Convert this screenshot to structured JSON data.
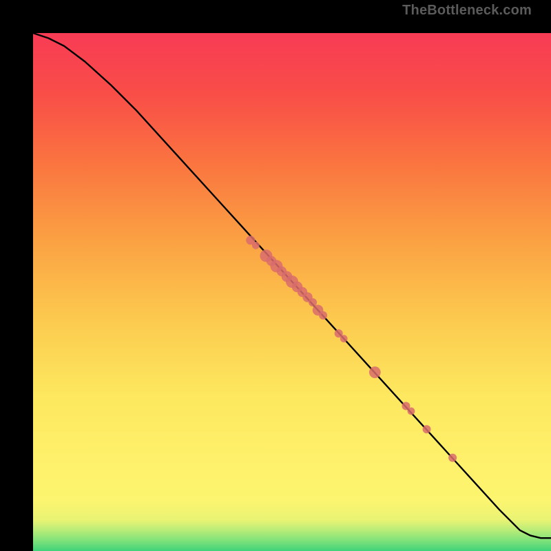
{
  "watermark": "TheBottleneck.com",
  "chart_data": {
    "type": "line",
    "title": "",
    "xlabel": "",
    "ylabel": "",
    "xlim": [
      0,
      100
    ],
    "ylim": [
      0,
      100
    ],
    "grid": false,
    "legend": false,
    "curve": {
      "name": "performance-curve",
      "x": [
        0,
        3,
        6,
        10,
        15,
        20,
        25,
        30,
        35,
        40,
        45,
        50,
        55,
        60,
        65,
        70,
        75,
        80,
        85,
        90,
        94,
        96,
        98,
        100
      ],
      "y": [
        100,
        99,
        97.5,
        94.5,
        90,
        85,
        79.5,
        74,
        68.5,
        63,
        57.5,
        52,
        46.5,
        41,
        35.5,
        30,
        24.5,
        19,
        13.5,
        8,
        4,
        3,
        2.5,
        2.5
      ]
    },
    "points": {
      "name": "data-points",
      "values": [
        {
          "x": 42,
          "y": 60,
          "r_rel": 1.1
        },
        {
          "x": 43,
          "y": 59,
          "r_rel": 0.9
        },
        {
          "x": 45,
          "y": 57,
          "r_rel": 1.5
        },
        {
          "x": 46,
          "y": 56,
          "r_rel": 1.2
        },
        {
          "x": 47,
          "y": 55,
          "r_rel": 1.5
        },
        {
          "x": 48,
          "y": 54,
          "r_rel": 1.2
        },
        {
          "x": 49,
          "y": 53,
          "r_rel": 1.3
        },
        {
          "x": 50,
          "y": 52,
          "r_rel": 1.5
        },
        {
          "x": 51,
          "y": 51,
          "r_rel": 1.3
        },
        {
          "x": 52,
          "y": 50,
          "r_rel": 1.2
        },
        {
          "x": 53,
          "y": 49,
          "r_rel": 1.2
        },
        {
          "x": 54,
          "y": 48,
          "r_rel": 1.0
        },
        {
          "x": 55,
          "y": 46.5,
          "r_rel": 1.3
        },
        {
          "x": 56,
          "y": 45.5,
          "r_rel": 1.0
        },
        {
          "x": 59,
          "y": 42,
          "r_rel": 1.0
        },
        {
          "x": 60,
          "y": 41,
          "r_rel": 0.9
        },
        {
          "x": 66,
          "y": 34.5,
          "r_rel": 1.4
        },
        {
          "x": 72,
          "y": 28,
          "r_rel": 1.0
        },
        {
          "x": 73,
          "y": 27,
          "r_rel": 0.9
        },
        {
          "x": 76,
          "y": 23.5,
          "r_rel": 1.0
        },
        {
          "x": 81,
          "y": 18,
          "r_rel": 1.0
        }
      ]
    },
    "gradient_bands": [
      {
        "stop": 0.0,
        "color": "#40d37a"
      },
      {
        "stop": 0.02,
        "color": "#7fe27a"
      },
      {
        "stop": 0.04,
        "color": "#b8ec78"
      },
      {
        "stop": 0.06,
        "color": "#e9f374"
      },
      {
        "stop": 0.1,
        "color": "#fdf56f"
      },
      {
        "stop": 0.18,
        "color": "#fef06a"
      },
      {
        "stop": 0.3,
        "color": "#fde85f"
      },
      {
        "stop": 0.45,
        "color": "#fcc94e"
      },
      {
        "stop": 0.6,
        "color": "#fba143"
      },
      {
        "stop": 0.75,
        "color": "#fa7440"
      },
      {
        "stop": 0.88,
        "color": "#f94e48"
      },
      {
        "stop": 1.0,
        "color": "#f83b55"
      }
    ],
    "point_color": "#d96c6c",
    "curve_color": "#000000"
  }
}
